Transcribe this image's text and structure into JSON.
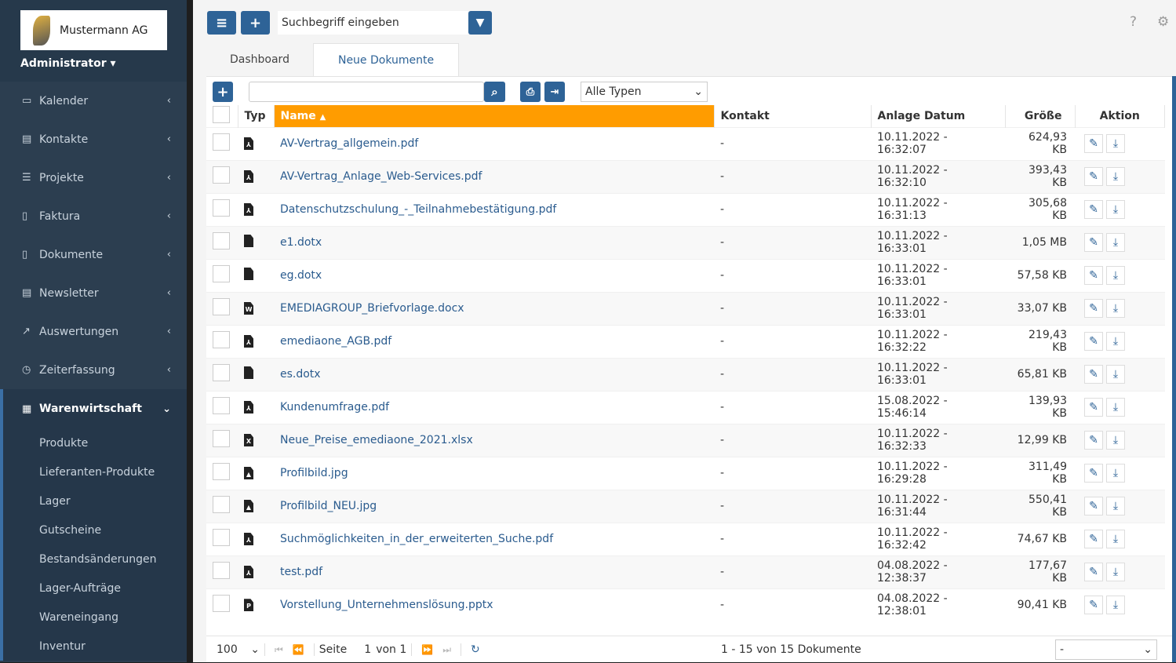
{
  "company": "Mustermann AG",
  "user": "Administrator",
  "nav": [
    {
      "label": "Kalender",
      "icon": "calendar-icon",
      "g": "▭"
    },
    {
      "label": "Kontakte",
      "icon": "contact-card-icon",
      "g": "▤"
    },
    {
      "label": "Projekte",
      "icon": "list-icon",
      "g": "☰"
    },
    {
      "label": "Faktura",
      "icon": "invoice-icon",
      "g": "▯"
    },
    {
      "label": "Dokumente",
      "icon": "document-icon",
      "g": "▯"
    },
    {
      "label": "Newsletter",
      "icon": "newspaper-icon",
      "g": "▤"
    },
    {
      "label": "Auswertungen",
      "icon": "chart-icon",
      "g": "↗"
    },
    {
      "label": "Zeiterfassung",
      "icon": "clock-icon",
      "g": "◷"
    }
  ],
  "active_nav": "Warenwirtschaft",
  "subnav": [
    "Produkte",
    "Lieferanten-Produkte",
    "Lager",
    "Gutscheine",
    "Bestandsänderungen",
    "Lager-Aufträge",
    "Wareneingang",
    "Inventur"
  ],
  "search_placeholder": "Suchbegriff eingeben",
  "tabs": [
    "Dashboard",
    "Neue Dokumente"
  ],
  "type_filter": "Alle Typen",
  "columns": {
    "typ": "Typ",
    "name": "Name",
    "kontakt": "Kontakt",
    "datum": "Anlage Datum",
    "groesse": "Größe",
    "aktion": "Aktion"
  },
  "rows": [
    {
      "type": "pdf",
      "name": "AV-Vertrag_allgemein.pdf",
      "kontakt": "-",
      "datum": "10.11.2022 - 16:32:07",
      "size": "624,93 KB"
    },
    {
      "type": "pdf",
      "name": "AV-Vertrag_Anlage_Web-Services.pdf",
      "kontakt": "-",
      "datum": "10.11.2022 - 16:32:10",
      "size": "393,43 KB"
    },
    {
      "type": "pdf",
      "name": "Datenschutzschulung_-_Teilnahmebestätigung.pdf",
      "kontakt": "-",
      "datum": "10.11.2022 - 16:31:13",
      "size": "305,68 KB"
    },
    {
      "type": "file",
      "name": "e1.dotx",
      "kontakt": "-",
      "datum": "10.11.2022 - 16:33:01",
      "size": "1,05 MB"
    },
    {
      "type": "file",
      "name": "eg.dotx",
      "kontakt": "-",
      "datum": "10.11.2022 - 16:33:01",
      "size": "57,58 KB"
    },
    {
      "type": "word",
      "name": "EMEDIAGROUP_Briefvorlage.docx",
      "kontakt": "-",
      "datum": "10.11.2022 - 16:33:01",
      "size": "33,07 KB"
    },
    {
      "type": "pdf",
      "name": "emediaone_AGB.pdf",
      "kontakt": "-",
      "datum": "10.11.2022 - 16:32:22",
      "size": "219,43 KB"
    },
    {
      "type": "file",
      "name": "es.dotx",
      "kontakt": "-",
      "datum": "10.11.2022 - 16:33:01",
      "size": "65,81 KB"
    },
    {
      "type": "pdf",
      "name": "Kundenumfrage.pdf",
      "kontakt": "-",
      "datum": "15.08.2022 - 15:46:14",
      "size": "139,93 KB"
    },
    {
      "type": "excel",
      "name": "Neue_Preise_emediaone_2021.xlsx",
      "kontakt": "-",
      "datum": "10.11.2022 - 16:32:33",
      "size": "12,99 KB"
    },
    {
      "type": "image",
      "name": "Profilbild.jpg",
      "kontakt": "-",
      "datum": "10.11.2022 - 16:29:28",
      "size": "311,49 KB"
    },
    {
      "type": "image",
      "name": "Profilbild_NEU.jpg",
      "kontakt": "-",
      "datum": "10.11.2022 - 16:31:44",
      "size": "550,41 KB"
    },
    {
      "type": "pdf",
      "name": "Suchmöglichkeiten_in_der_erweiterten_Suche.pdf",
      "kontakt": "-",
      "datum": "10.11.2022 - 16:32:42",
      "size": "74,67 KB"
    },
    {
      "type": "pdf",
      "name": "test.pdf",
      "kontakt": "-",
      "datum": "04.08.2022 - 12:38:37",
      "size": "177,67 KB"
    },
    {
      "type": "powerpoint",
      "name": "Vorstellung_Unternehmenslösung.pptx",
      "kontakt": "-",
      "datum": "04.08.2022 - 12:38:01",
      "size": "90,41 KB"
    }
  ],
  "footer": {
    "page_size": "100",
    "seite": "Seite",
    "page": "1",
    "von": "von 1",
    "summary": "1 - 15 von 15 Dokumente",
    "action_select": "-"
  }
}
